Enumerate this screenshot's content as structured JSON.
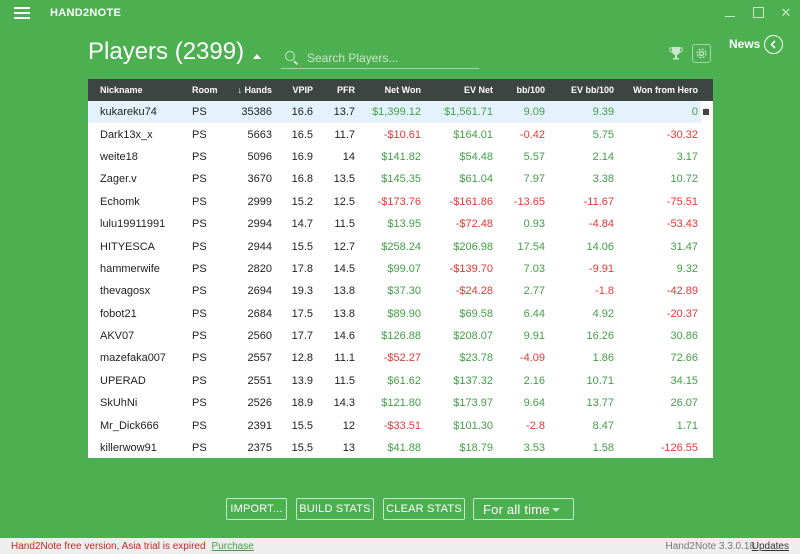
{
  "window": {
    "title": "HAND2NOTE"
  },
  "header": {
    "title": "Players (2399)",
    "search_placeholder": "Search Players...",
    "news_label": "News"
  },
  "table": {
    "columns": [
      "Nickname",
      "Room",
      "Hands",
      "VPIP",
      "PFR",
      "Net Won",
      "EV Net",
      "bb/100",
      "EV bb/100",
      "Won from Hero"
    ],
    "sort_column": "Hands",
    "sort_direction": "descending",
    "rows": [
      {
        "nick": "kukareku74",
        "room": "PS",
        "hands": "35386",
        "vpip": "16.6",
        "pfr": "13.7",
        "net": "$1,399.12",
        "ev": "$1,561.71",
        "bb": "9.09",
        "evbb": "9.39",
        "won": "0"
      },
      {
        "nick": "Dark13x_x",
        "room": "PS",
        "hands": "5663",
        "vpip": "16.5",
        "pfr": "11.7",
        "net": "-$10.61",
        "ev": "$164.01",
        "bb": "-0.42",
        "evbb": "5.75",
        "won": "-30.32"
      },
      {
        "nick": "weite18",
        "room": "PS",
        "hands": "5096",
        "vpip": "16.9",
        "pfr": "14",
        "net": "$141.82",
        "ev": "$54.48",
        "bb": "5.57",
        "evbb": "2.14",
        "won": "3.17"
      },
      {
        "nick": "Zager.v",
        "room": "PS",
        "hands": "3670",
        "vpip": "16.8",
        "pfr": "13.5",
        "net": "$145.35",
        "ev": "$61.04",
        "bb": "7.97",
        "evbb": "3.38",
        "won": "10.72"
      },
      {
        "nick": "Echomk",
        "room": "PS",
        "hands": "2999",
        "vpip": "15.2",
        "pfr": "12.5",
        "net": "-$173.76",
        "ev": "-$161.86",
        "bb": "-13.65",
        "evbb": "-11.67",
        "won": "-75.51"
      },
      {
        "nick": "lulu19911991",
        "room": "PS",
        "hands": "2994",
        "vpip": "14.7",
        "pfr": "11.5",
        "net": "$13.95",
        "ev": "-$72.48",
        "bb": "0.93",
        "evbb": "-4.84",
        "won": "-53.43"
      },
      {
        "nick": "HITYESCA",
        "room": "PS",
        "hands": "2944",
        "vpip": "15.5",
        "pfr": "12.7",
        "net": "$258.24",
        "ev": "$206.98",
        "bb": "17.54",
        "evbb": "14.06",
        "won": "31.47"
      },
      {
        "nick": "hammerwife",
        "room": "PS",
        "hands": "2820",
        "vpip": "17.8",
        "pfr": "14.5",
        "net": "$99.07",
        "ev": "-$139.70",
        "bb": "7.03",
        "evbb": "-9.91",
        "won": "9.32"
      },
      {
        "nick": "thevagosx",
        "room": "PS",
        "hands": "2694",
        "vpip": "19.3",
        "pfr": "13.8",
        "net": "$37.30",
        "ev": "-$24.28",
        "bb": "2.77",
        "evbb": "-1.8",
        "won": "-42.89"
      },
      {
        "nick": "fobot21",
        "room": "PS",
        "hands": "2684",
        "vpip": "17.5",
        "pfr": "13.8",
        "net": "$89.90",
        "ev": "$69.58",
        "bb": "6.44",
        "evbb": "4.92",
        "won": "-20.37"
      },
      {
        "nick": "AKV07",
        "room": "PS",
        "hands": "2560",
        "vpip": "17.7",
        "pfr": "14.6",
        "net": "$126.88",
        "ev": "$208.07",
        "bb": "9.91",
        "evbb": "16.26",
        "won": "30.86"
      },
      {
        "nick": "mazefaka007",
        "room": "PS",
        "hands": "2557",
        "vpip": "12.8",
        "pfr": "11.1",
        "net": "-$52.27",
        "ev": "$23.78",
        "bb": "-4.09",
        "evbb": "1.86",
        "won": "72.66"
      },
      {
        "nick": "UPERAD",
        "room": "PS",
        "hands": "2551",
        "vpip": "13.9",
        "pfr": "11.5",
        "net": "$61.62",
        "ev": "$137.32",
        "bb": "2.16",
        "evbb": "10.71",
        "won": "34.15"
      },
      {
        "nick": "SkUhNi",
        "room": "PS",
        "hands": "2526",
        "vpip": "18.9",
        "pfr": "14.3",
        "net": "$121.80",
        "ev": "$173.97",
        "bb": "9.64",
        "evbb": "13.77",
        "won": "26.07"
      },
      {
        "nick": "Mr_Dick666",
        "room": "PS",
        "hands": "2391",
        "vpip": "15.5",
        "pfr": "12",
        "net": "-$33.51",
        "ev": "$101.30",
        "bb": "-2.8",
        "evbb": "8.47",
        "won": "1.71"
      },
      {
        "nick": "killerwow91",
        "room": "PS",
        "hands": "2375",
        "vpip": "15.5",
        "pfr": "13",
        "net": "$41.88",
        "ev": "$18.79",
        "bb": "3.53",
        "evbb": "1.58",
        "won": "-126.55"
      }
    ]
  },
  "buttons": {
    "import": "IMPORT...",
    "build": "BUILD STATS",
    "clear": "CLEAR STATS",
    "time_filter": "For all time"
  },
  "status": {
    "trial": "Hand2Note free version, Asia trial is expired",
    "purchase": "Purchase",
    "version": "Hand2Note 3.3.0.18",
    "updates": "Updates"
  },
  "colors": {
    "background": "#4caf50",
    "positive": "#43a047",
    "negative": "#e53935",
    "header_bg": "#3d4543",
    "selected_row": "#e3f2fd"
  }
}
